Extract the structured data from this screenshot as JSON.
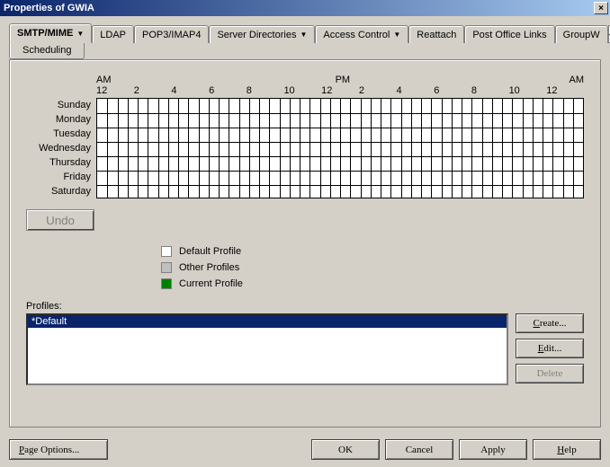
{
  "window": {
    "title": "Properties of GWIA",
    "close_label": "×"
  },
  "tabs": {
    "items": [
      {
        "label": "SMTP/MIME",
        "dropdown": true,
        "active": true
      },
      {
        "label": "LDAP"
      },
      {
        "label": "POP3/IMAP4"
      },
      {
        "label": "Server Directories",
        "dropdown": true
      },
      {
        "label": "Access Control",
        "dropdown": true
      },
      {
        "label": "Reattach"
      },
      {
        "label": "Post Office Links"
      },
      {
        "label": "GroupW"
      }
    ],
    "sub_tab": "Scheduling"
  },
  "schedule": {
    "top_markers": {
      "am_left": "AM",
      "pm": "PM",
      "am_right": "AM"
    },
    "hours": [
      "12",
      "2",
      "4",
      "6",
      "8",
      "10",
      "12",
      "2",
      "4",
      "6",
      "8",
      "10",
      "12"
    ],
    "days": [
      "Sunday",
      "Monday",
      "Tuesday",
      "Wednesday",
      "Thursday",
      "Friday",
      "Saturday"
    ]
  },
  "buttons": {
    "undo": "Undo",
    "create": "Create...",
    "edit": "Edit...",
    "delete": "Delete",
    "page_options": "Page Options...",
    "ok": "OK",
    "cancel": "Cancel",
    "apply": "Apply",
    "help": "Help"
  },
  "legend": {
    "default_profile": "Default Profile",
    "other_profiles": "Other Profiles",
    "current_profile": "Current Profile"
  },
  "profiles": {
    "label": "Profiles:",
    "items": [
      "*Default"
    ],
    "selected_index": 0
  }
}
